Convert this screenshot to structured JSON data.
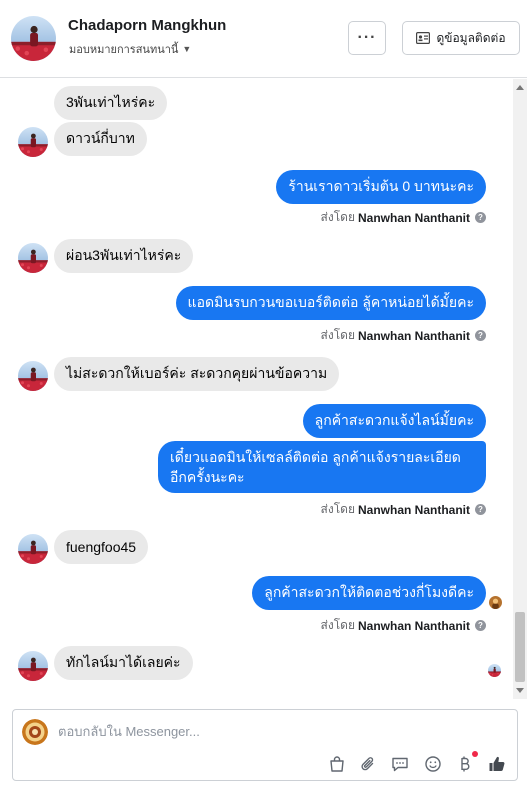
{
  "header": {
    "name": "Chadaporn Mangkhun",
    "subtitle": "มอบหมายการสนทนานี้",
    "more_label": "···",
    "contact_label": "ดูข้อมูลติดต่อ"
  },
  "messages": [
    {
      "from": "customer",
      "text": "3พันเท่าไหร่คะ"
    },
    {
      "from": "customer",
      "text": "ดาวน์กี่บาท"
    },
    {
      "from": "page",
      "text": "ร้านเราดาวเริ่มต้น 0 บาทนะคะ"
    },
    {
      "from": "customer",
      "text": "ผ่อน3พันเท่าไหร่คะ"
    },
    {
      "from": "page",
      "text": "แอดมินรบกวนขอเบอร์ติดต่อ ลู้คาหน่อยได้มั้ยคะ"
    },
    {
      "from": "customer",
      "text": "ไม่สะดวกให้เบอร์ค่ะ  สะดวกคุยผ่านข้อความ"
    },
    {
      "from": "page",
      "text": "ลูกค้าสะดวกแจ้งไลน์มั้ยคะ"
    },
    {
      "from": "page",
      "text": "เดี๋ยวแอดมินให้เซลล์ติดต่อ ลูกค้าแจ้งรายละเอียดอีกครั้งนะคะ"
    },
    {
      "from": "customer",
      "text": "fuengfoo45"
    },
    {
      "from": "page",
      "text": "ลูกค้าสะดวกให้ติดตอช่วงกี่โมงดีคะ"
    },
    {
      "from": "customer",
      "text": "ทักไลน์มาได้เลยค่ะ"
    }
  ],
  "sent_by": {
    "prefix": "ส่งโดย",
    "agent": "Nanwhan Nanthanit",
    "help_icon": "?"
  },
  "composer": {
    "placeholder": "ตอบกลับใน Messenger..."
  },
  "icons": {
    "shop": "shop-bag-icon",
    "attach": "paperclip-icon",
    "saved_replies": "chat-bubble-icon",
    "emoji": "smiley-icon",
    "payment": "baht-icon",
    "like": "thumbs-up-icon"
  },
  "colors": {
    "outgoing_bubble": "#1877f2",
    "incoming_bubble": "#e9e9e9",
    "notification_dot": "#f02849"
  }
}
